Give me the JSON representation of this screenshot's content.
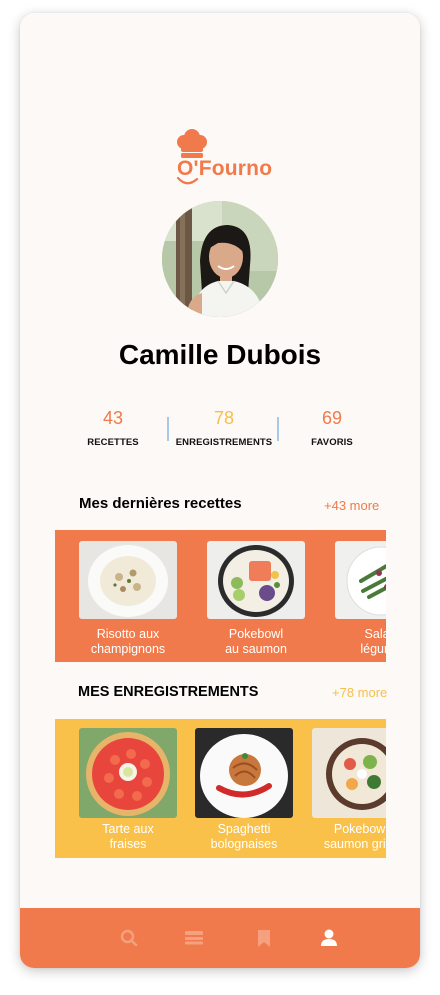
{
  "app": {
    "logo_text": "O'Fourno"
  },
  "profile": {
    "name": "Camille Dubois"
  },
  "stats": [
    {
      "value": "43",
      "label": "RECETTES"
    },
    {
      "value": "78",
      "label": "ENREGISTREMENTS"
    },
    {
      "value": "69",
      "label": "FAVORIS"
    }
  ],
  "recent": {
    "title": "Mes dernières recettes",
    "more": "+43 more",
    "color": "#f07a4b",
    "items": [
      {
        "line1": "Risotto aux",
        "line2": "champignons"
      },
      {
        "line1": "Pokebowl",
        "line2": "au saumon"
      },
      {
        "line1": "Salade",
        "line2": "légumes"
      }
    ]
  },
  "saved": {
    "title": "MES ENREGISTREMENTS",
    "more": "+78 more",
    "color": "#f9c04a",
    "items": [
      {
        "line1": "Tarte aux",
        "line2": "fraises"
      },
      {
        "line1": "Spaghetti",
        "line2": "bolognaises"
      },
      {
        "line1": "Pokebowl",
        "line2": "saumon grillé"
      }
    ]
  },
  "nav": [
    {
      "icon": "search-icon"
    },
    {
      "icon": "list-icon"
    },
    {
      "icon": "bookmark-icon"
    },
    {
      "icon": "user-icon",
      "active": true
    }
  ],
  "colors": {
    "accent": "#f07a4b",
    "yellow": "#f9c04a",
    "nav_inactive": "#f5a07e"
  }
}
